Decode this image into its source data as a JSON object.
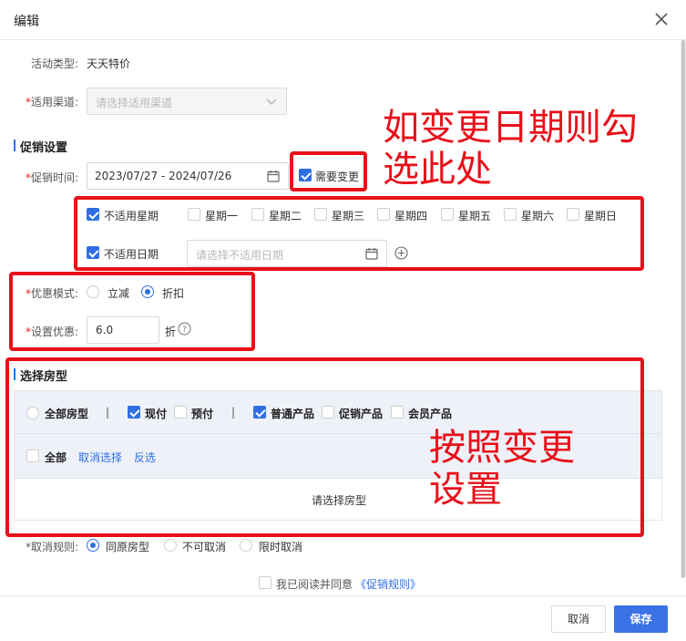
{
  "dialog": {
    "title": "编辑",
    "close_icon": "close-icon"
  },
  "activity": {
    "label": "活动类型:",
    "value": "天天特价"
  },
  "channel": {
    "required": "*",
    "label": "适用渠道:",
    "placeholder": "请选择适用渠道"
  },
  "promo_section": {
    "title": "促销设置"
  },
  "promo_time": {
    "required": "*",
    "label": "促销时间:",
    "value": "2023/07/27 - 2024/07/26",
    "need_change_label": "需要变更",
    "need_change_checked": true
  },
  "weekdays": {
    "label": "不适用星期",
    "checked": true,
    "items": [
      {
        "label": "星期一",
        "checked": false
      },
      {
        "label": "星期二",
        "checked": false
      },
      {
        "label": "星期三",
        "checked": false
      },
      {
        "label": "星期四",
        "checked": false
      },
      {
        "label": "星期五",
        "checked": false
      },
      {
        "label": "星期六",
        "checked": false
      },
      {
        "label": "星期日",
        "checked": false
      }
    ]
  },
  "exclude_dates": {
    "label": "不适用日期",
    "checked": true,
    "placeholder": "请选择不适用日期"
  },
  "discount_mode": {
    "required": "*",
    "label": "优惠模式:",
    "options": [
      {
        "label": "立减",
        "selected": false
      },
      {
        "label": "折扣",
        "selected": true
      }
    ]
  },
  "discount_value": {
    "required": "*",
    "label": "设置优惠:",
    "value": "6.0",
    "unit": "折"
  },
  "room_section": {
    "title": "选择房型"
  },
  "room_filter": {
    "all_rooms": "全部房型",
    "sep": "|",
    "pay_now": "现付",
    "pay_now_checked": true,
    "prepay": "预付",
    "prepay_checked": false,
    "normal": "普通产品",
    "normal_checked": true,
    "promo": "促销产品",
    "promo_checked": false,
    "member": "会员产品",
    "member_checked": false,
    "select_all": "全部",
    "deselect": "取消选择",
    "invert": "反选",
    "placeholder": "请选择房型"
  },
  "cancel_rule": {
    "label": "*取消规则:",
    "options": [
      {
        "label": "同原房型",
        "selected": true
      },
      {
        "label": "不可取消",
        "selected": false
      },
      {
        "label": "限时取消",
        "selected": false
      }
    ]
  },
  "agreement": {
    "text": "我已阅读并同意",
    "link": "《促销规则》"
  },
  "footer": {
    "cancel": "取消",
    "save": "保存"
  },
  "annotations": {
    "note1_line1": "如变更日期则勾",
    "note1_line2": "选此处",
    "note2_line1": "按照变更",
    "note2_line2": "设置",
    "color": "#e8101a"
  },
  "colors": {
    "accent": "#2f6fe4",
    "required": "#e02020"
  }
}
